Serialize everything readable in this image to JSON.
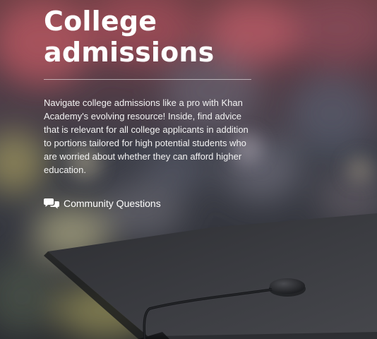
{
  "hero": {
    "title": "College admissions",
    "description": "Navigate college admissions like a pro with Khan Academy's evolving resource! Inside, find advice that is relevant for all college applicants in addition to portions tailored for high potential students who are worried about whether they can afford higher education.",
    "community_link": {
      "label": "Community Questions",
      "icon": "chat-bubbles-icon"
    }
  },
  "colors": {
    "text": "#ffffff",
    "divider": "#c9c9c9"
  }
}
